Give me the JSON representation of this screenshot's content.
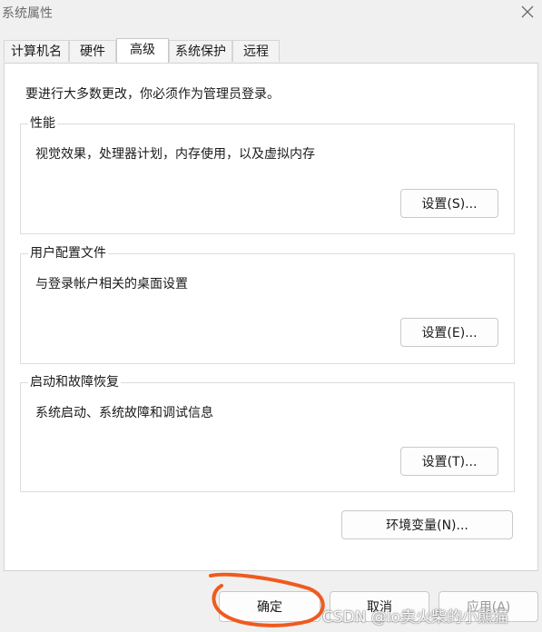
{
  "window": {
    "title": "系统属性"
  },
  "tabs": [
    {
      "label": "计算机名"
    },
    {
      "label": "硬件"
    },
    {
      "label": "高级",
      "active": true
    },
    {
      "label": "系统保护"
    },
    {
      "label": "远程"
    }
  ],
  "intro": "要进行大多数更改，你必须作为管理员登录。",
  "groups": {
    "performance": {
      "title": "性能",
      "description": "视觉效果，处理器计划，内存使用，以及虚拟内存",
      "button": "设置(S)..."
    },
    "profiles": {
      "title": "用户配置文件",
      "description": "与登录帐户相关的桌面设置",
      "button": "设置(E)..."
    },
    "startup": {
      "title": "启动和故障恢复",
      "description": "系统启动、系统故障和调试信息",
      "button": "设置(T)..."
    }
  },
  "env_button": "环境变量(N)...",
  "footer": {
    "ok": "确定",
    "cancel": "取消",
    "apply": "应用(A)"
  },
  "watermark": "CSDN @lo卖火柴的小熊猫",
  "icons": {
    "close": "close-icon"
  },
  "colors": {
    "annotation": "#f05a1e",
    "panel": "#ffffff",
    "background": "#f0f0f0"
  }
}
